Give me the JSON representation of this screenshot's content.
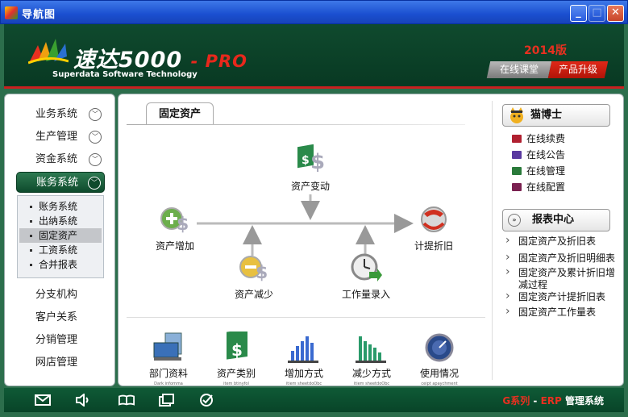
{
  "window": {
    "title": "导航图"
  },
  "header": {
    "brand": "速达5000",
    "brand_suffix": "- PRO",
    "subtitle": "Superdata Software Technology",
    "year": "2014版",
    "online_class": "在线课堂",
    "upgrade": "产品升级"
  },
  "sidebar": {
    "items": [
      {
        "label": "业务系统"
      },
      {
        "label": "生产管理"
      },
      {
        "label": "资金系统"
      },
      {
        "label": "账务系统"
      }
    ],
    "submenu": [
      {
        "label": "账务系统"
      },
      {
        "label": "出纳系统"
      },
      {
        "label": "固定资产"
      },
      {
        "label": "工资系统"
      },
      {
        "label": "合并报表"
      }
    ],
    "more": [
      {
        "label": "分支机构"
      },
      {
        "label": "客户关系"
      },
      {
        "label": "分销管理"
      },
      {
        "label": "网店管理"
      }
    ]
  },
  "main": {
    "tab": "固定资产",
    "flow": {
      "change": "资产变动",
      "increase": "资产增加",
      "decrease": "资产减少",
      "workload": "工作量录入",
      "depreciation": "计提折旧"
    },
    "bottom": [
      {
        "label": "部门资料",
        "tiny": "Dark infomma"
      },
      {
        "label": "资产类别",
        "tiny": "item btinyfol"
      },
      {
        "label": "增加方式",
        "tiny": "itiem sheetdoObc"
      },
      {
        "label": "减少方式",
        "tiny": "itiem sheetdoObc"
      },
      {
        "label": "使用情况",
        "tiny": "ceipt apaychment"
      }
    ]
  },
  "doctor": {
    "title": "猫博士",
    "links": [
      {
        "label": "在线续费",
        "color": "#b02030"
      },
      {
        "label": "在线公告",
        "color": "#5a3aa0"
      },
      {
        "label": "在线管理",
        "color": "#2a7a3a"
      },
      {
        "label": "在线配置",
        "color": "#7a2050"
      }
    ]
  },
  "reports": {
    "title": "报表中心",
    "links": [
      {
        "label": "固定资产及折旧表"
      },
      {
        "label": "固定资产及折旧明细表"
      },
      {
        "label": "固定资产及累计折旧增减过程"
      },
      {
        "label": "固定资产计提折旧表"
      },
      {
        "label": "固定资产工作量表"
      }
    ]
  },
  "footer": {
    "brand_g": "G系列",
    "brand_dash": " - ",
    "brand_erp": "ERP",
    "brand_rest": " 管理系统"
  }
}
